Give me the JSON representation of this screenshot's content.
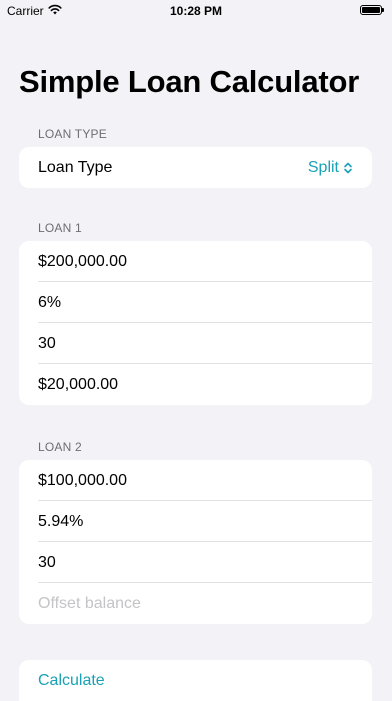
{
  "status_bar": {
    "carrier": "Carrier",
    "time": "10:28 PM"
  },
  "title": "Simple Loan Calculator",
  "loan_type_section": {
    "header": "LOAN TYPE",
    "label": "Loan Type",
    "value": "Split"
  },
  "loan1": {
    "header": "LOAN 1",
    "amount": "$200,000.00",
    "rate": "6%",
    "term": "30",
    "offset": "$20,000.00"
  },
  "loan2": {
    "header": "LOAN 2",
    "amount": "$100,000.00",
    "rate": "5.94%",
    "term": "30",
    "offset_placeholder": "Offset balance"
  },
  "calculate_label": "Calculate",
  "colors": {
    "accent": "#1aa1b5",
    "background": "#f2f2f7",
    "card": "#ffffff"
  }
}
